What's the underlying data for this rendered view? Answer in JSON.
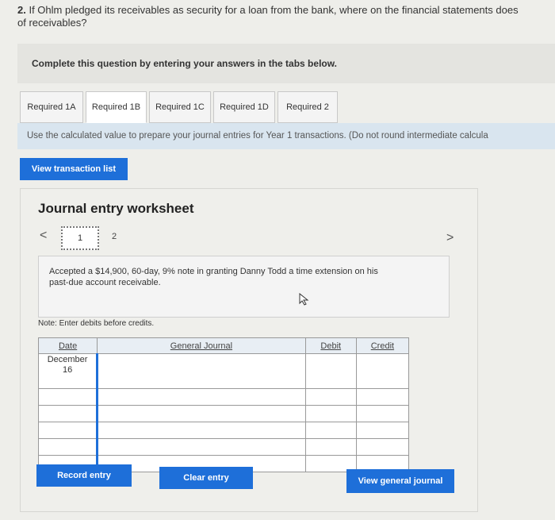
{
  "question": {
    "number": "2.",
    "text": "If Ohlm pledged its receivables as security for a loan from the bank, where on the financial statements does",
    "text_line2": "of receivables?"
  },
  "instruction": "Complete this question by entering your answers in the tabs below.",
  "tabs": [
    {
      "label": "Required 1A"
    },
    {
      "label": "Required 1B"
    },
    {
      "label": "Required 1C"
    },
    {
      "label": "Required 1D"
    },
    {
      "label": "Required 2"
    }
  ],
  "active_tab": "Required 1B",
  "use_text": "Use the calculated value to prepare your journal entries for Year 1 transactions. (Do not round intermediate calcula",
  "view_transaction_list_label": "View transaction list",
  "worksheet": {
    "title": "Journal entry worksheet",
    "pages": [
      "1",
      "2"
    ],
    "current_page": "1",
    "prev_icon": "<",
    "next_icon": ">",
    "transaction": "Accepted a $14,900, 60-day, 9% note in granting Danny Todd a time extension on his past-due account receivable.",
    "note": "Note: Enter debits before credits."
  },
  "journal": {
    "headers": {
      "date": "Date",
      "account": "General Journal",
      "debit": "Debit",
      "credit": "Credit"
    },
    "rows": [
      {
        "date_line1": "December",
        "date_line2": "16",
        "account": "",
        "debit": "",
        "credit": ""
      },
      {
        "date_line1": "",
        "date_line2": "",
        "account": "",
        "debit": "",
        "credit": ""
      },
      {
        "date_line1": "",
        "date_line2": "",
        "account": "",
        "debit": "",
        "credit": ""
      },
      {
        "date_line1": "",
        "date_line2": "",
        "account": "",
        "debit": "",
        "credit": ""
      },
      {
        "date_line1": "",
        "date_line2": "",
        "account": "",
        "debit": "",
        "credit": ""
      },
      {
        "date_line1": "",
        "date_line2": "",
        "account": "",
        "debit": "",
        "credit": ""
      }
    ]
  },
  "buttons": {
    "record_entry": "Record entry",
    "clear_entry": "Clear entry",
    "view_general_journal": "View general journal"
  },
  "colors": {
    "accent": "#1e6fd9",
    "tab_content_bg": "#d9e5ef"
  }
}
